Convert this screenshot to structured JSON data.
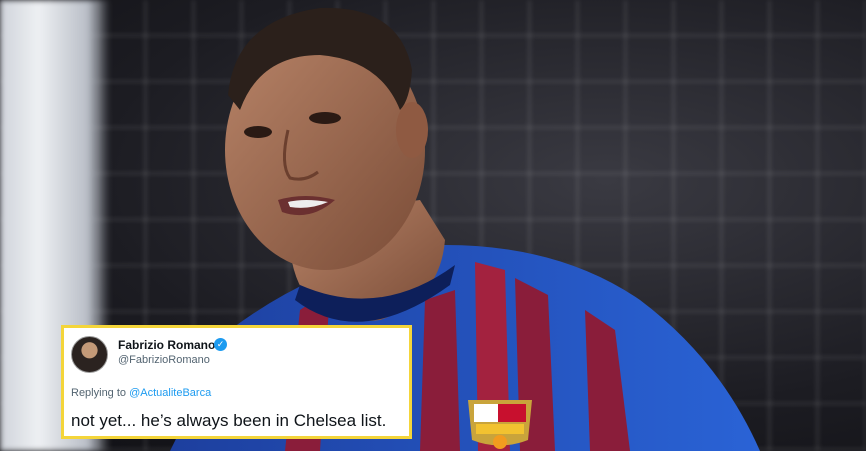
{
  "tweet": {
    "author_name": "Fabrizio Romano",
    "author_handle": "@FabrizioRomano",
    "reply_prefix": "Replying to",
    "reply_to": "@ActualiteBarca",
    "text": "not yet... he’s always been in Chelsea list."
  },
  "colors": {
    "highlight_border": "#f4d53a",
    "verified": "#1d9bf0",
    "link": "#1d9bf0"
  }
}
